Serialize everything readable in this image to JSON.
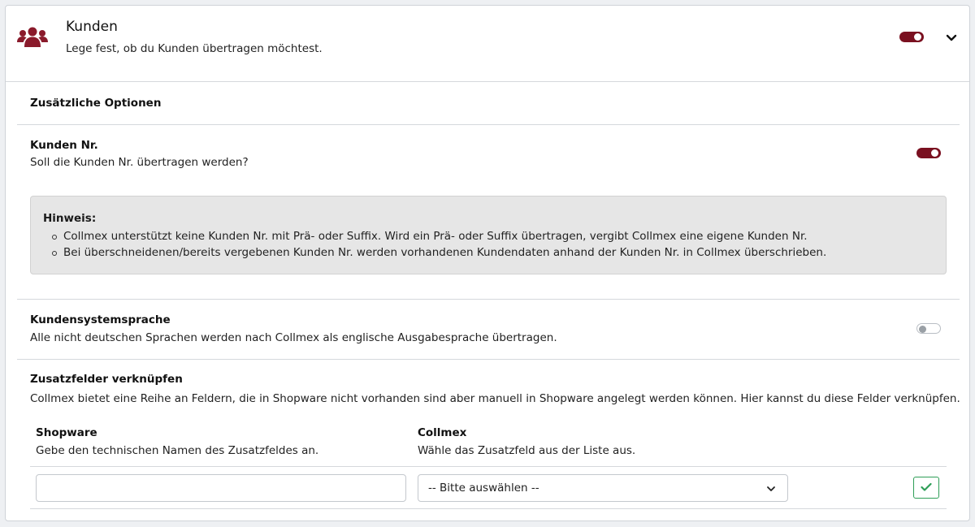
{
  "header": {
    "title": "Kunden",
    "subtitle": "Lege fest, ob du Kunden übertragen möchtest.",
    "icon": "users-icon",
    "toggle_on": true
  },
  "additional_options": {
    "heading": "Zusätzliche Optionen"
  },
  "customer_number": {
    "title": "Kunden Nr.",
    "description": "Soll die Kunden Nr. übertragen werden?",
    "toggle_on": true
  },
  "hint": {
    "title": "Hinweis:",
    "items": [
      "Collmex unterstützt keine Kunden Nr. mit Prä- oder Suffix. Wird ein Prä- oder Suffix übertragen, vergibt Collmex eine eigene Kunden Nr.",
      "Bei überschneidenen/bereits vergebenen Kunden Nr. werden vorhandenen Kundendaten anhand der Kunden Nr. in Collmex überschrieben."
    ]
  },
  "system_language": {
    "title": "Kundensystemsprache",
    "description": "Alle nicht deutschen Sprachen werden nach Collmex als englische Ausgabesprache übertragen.",
    "toggle_on": false
  },
  "custom_fields": {
    "title": "Zusatzfelder verknüpfen",
    "description": "Collmex bietet eine Reihe an Feldern, die in Shopware nicht vorhanden sind aber manuell in Shopware angelegt werden können. Hier kannst du diese Felder verknüpfen.",
    "shopware_column": {
      "title": "Shopware",
      "description": "Gebe den technischen Namen des Zusatzfeldes an."
    },
    "collmex_column": {
      "title": "Collmex",
      "description": "Wähle das Zusatzfeld aus der Liste aus."
    },
    "shopware_input_value": "",
    "collmex_select_value": "-- Bitte auswählen --"
  },
  "colors": {
    "accent": "#7a1020",
    "success": "#2e9e57"
  }
}
